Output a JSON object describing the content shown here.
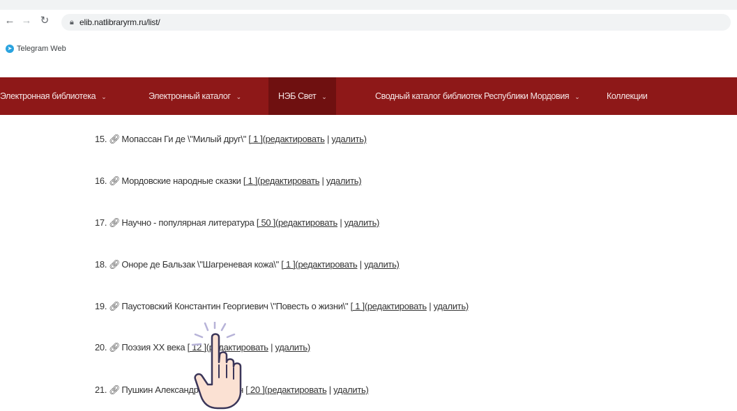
{
  "browser": {
    "url": "elib.natlibraryrm.ru/list/",
    "bookmark": "Telegram Web"
  },
  "nav": {
    "items": [
      {
        "label": "Электронная библиотека",
        "caret": "⌄"
      },
      {
        "label": "Электронный каталог",
        "caret": "⌄"
      },
      {
        "label": "НЭБ Свет",
        "caret": "⌄"
      },
      {
        "label": "Сводный каталог библиотек Республики Мордовия",
        "caret": "⌄"
      },
      {
        "label": "Коллекции",
        "caret": ""
      }
    ]
  },
  "list": {
    "rows": [
      {
        "num": "15.",
        "title": "Мопассан Ги де \\\"Милый друг\\\"",
        "count": "[ 1 ]",
        "edit": "(редактировать",
        "delete": "удалить)"
      },
      {
        "num": "16.",
        "title": "Мордовские народные сказки",
        "count": "[ 1 ]",
        "edit": "(редактировать",
        "delete": "удалить)"
      },
      {
        "num": "17.",
        "title": "Научно - популярная литература",
        "count": "[ 50 ]",
        "edit": "(редактировать",
        "delete": "удалить)"
      },
      {
        "num": "18.",
        "title": "Оноре де Бальзак \\\"Шагреневая кожа\\\"",
        "count": "[ 1 ]",
        "edit": "(редактировать",
        "delete": "удалить)"
      },
      {
        "num": "19.",
        "title": "Паустовский Константин Георгиевич \\\"Повесть о жизни\\\"",
        "count": "[ 1 ]",
        "edit": "(редактировать",
        "delete": "удалить)"
      },
      {
        "num": "20.",
        "title": "Поэзия XX века",
        "count": "[ 12 ]",
        "edit": "(редактировать",
        "delete": "удалить)"
      },
      {
        "num": "21.",
        "title": "Пушкин Александр Сергеевич",
        "count": "[ 20 ]",
        "edit": "(редактировать",
        "delete": "удалить)"
      }
    ]
  }
}
